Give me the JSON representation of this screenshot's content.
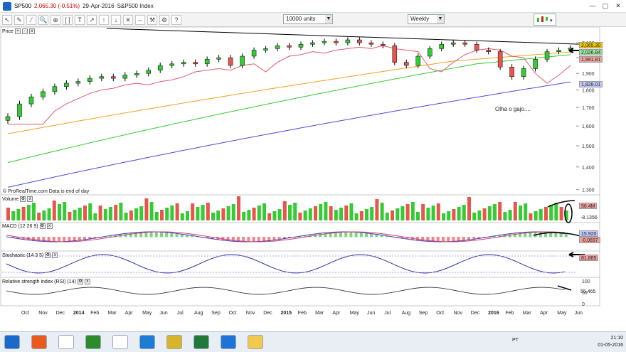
{
  "window": {
    "symbol": "SP500",
    "change": "2,065.30 (-0.51%)",
    "date": "29-Apr-2016",
    "index_name": "S&P500 Index",
    "controls": [
      "—",
      "▢",
      "✕"
    ]
  },
  "toolbar": {
    "icons": [
      "cursor-icon",
      "pencil-icon",
      "draw-icon",
      "search-icon",
      "zoom-icon",
      "bracket-icon",
      "text-icon",
      "arrow-icon",
      "arrow-up-icon",
      "arrow-down-icon",
      "cross-icon",
      "measure-icon",
      "tools-icon",
      "settings-icon",
      "help-icon"
    ],
    "units_value": "10000 units",
    "period_value": "Weekly"
  },
  "price_panel": {
    "label": "Price",
    "credit": "© ProRealTime.com  Data is end of day",
    "annotation": "Olha o gajo....",
    "price_tags": [
      {
        "text": "2,065.30",
        "color": "#f5c800"
      },
      {
        "text": "2,026.84",
        "color": "#9be69b"
      },
      {
        "text": "1,991.81",
        "color": "#f2a0a0"
      },
      {
        "text": "1,828.01",
        "color": "#c0c8ff"
      }
    ],
    "y_ticks": [
      "2,100",
      "2,000",
      "1,900",
      "1,800",
      "1,700",
      "1,600",
      "1,500",
      "1,400",
      "1,300"
    ]
  },
  "volume_panel": {
    "label": "Volume",
    "tags": [
      "56.4M",
      "-8.1356"
    ]
  },
  "macd_panel": {
    "label": "MACD (12 26 9)",
    "tags": [
      "15.920",
      "-0.0697"
    ]
  },
  "stochastic_panel": {
    "label": "Stochastic (14 3 5)",
    "tags": [
      "81.885"
    ]
  },
  "rsi_panel": {
    "label": "Relative strength index (RSI) (14)",
    "tags": [
      "55.465"
    ],
    "y_ticks": [
      "100",
      "50",
      "0"
    ]
  },
  "x_axis": {
    "labels": [
      "Oct",
      "Nov",
      "Dec",
      "2014",
      "Feb",
      "Mar",
      "Apr",
      "May",
      "Jun",
      "Jul",
      "Aug",
      "Sep",
      "Oct",
      "Nov",
      "Dec",
      "2015",
      "Feb",
      "Mar",
      "Apr",
      "May",
      "Jun",
      "Jul",
      "Aug",
      "Sep",
      "Oct",
      "Nov",
      "Dec",
      "2016",
      "Feb",
      "Mar",
      "Apr",
      "May",
      "Jun"
    ]
  },
  "taskbar": {
    "apps": [
      "start-icon",
      "media-player-icon",
      "file-explorer-icon",
      "app-icon",
      "chrome-icon",
      "app-circle-icon",
      "prorealtime-icon",
      "excel-icon",
      "edge-icon",
      "paint-icon"
    ],
    "lang": "PT",
    "time": "21:10",
    "date": "01-05-2016"
  },
  "chart_data": {
    "type": "line",
    "title": "",
    "xlabel": "",
    "ylabel": "",
    "ylim": [
      1290,
      2140
    ],
    "log_scale": true,
    "grid": false,
    "series": [
      {
        "values": [
          1650,
          1720,
          1760,
          1790,
          1820,
          1840,
          1850,
          1870,
          1880,
          1870,
          1890,
          1900,
          1920,
          1950,
          1960,
          1970,
          1960,
          1990,
          2000,
          1950,
          2010,
          2050,
          2060,
          2080,
          2070,
          2090,
          2100,
          2110,
          2100,
          2120,
          2100,
          2090,
          2080,
          1970,
          1950,
          2010,
          2060,
          2090,
          2100,
          2090,
          2050,
          2040,
          1940,
          1880,
          1930,
          1990,
          2040,
          2050,
          2065
        ]
      }
    ]
  }
}
